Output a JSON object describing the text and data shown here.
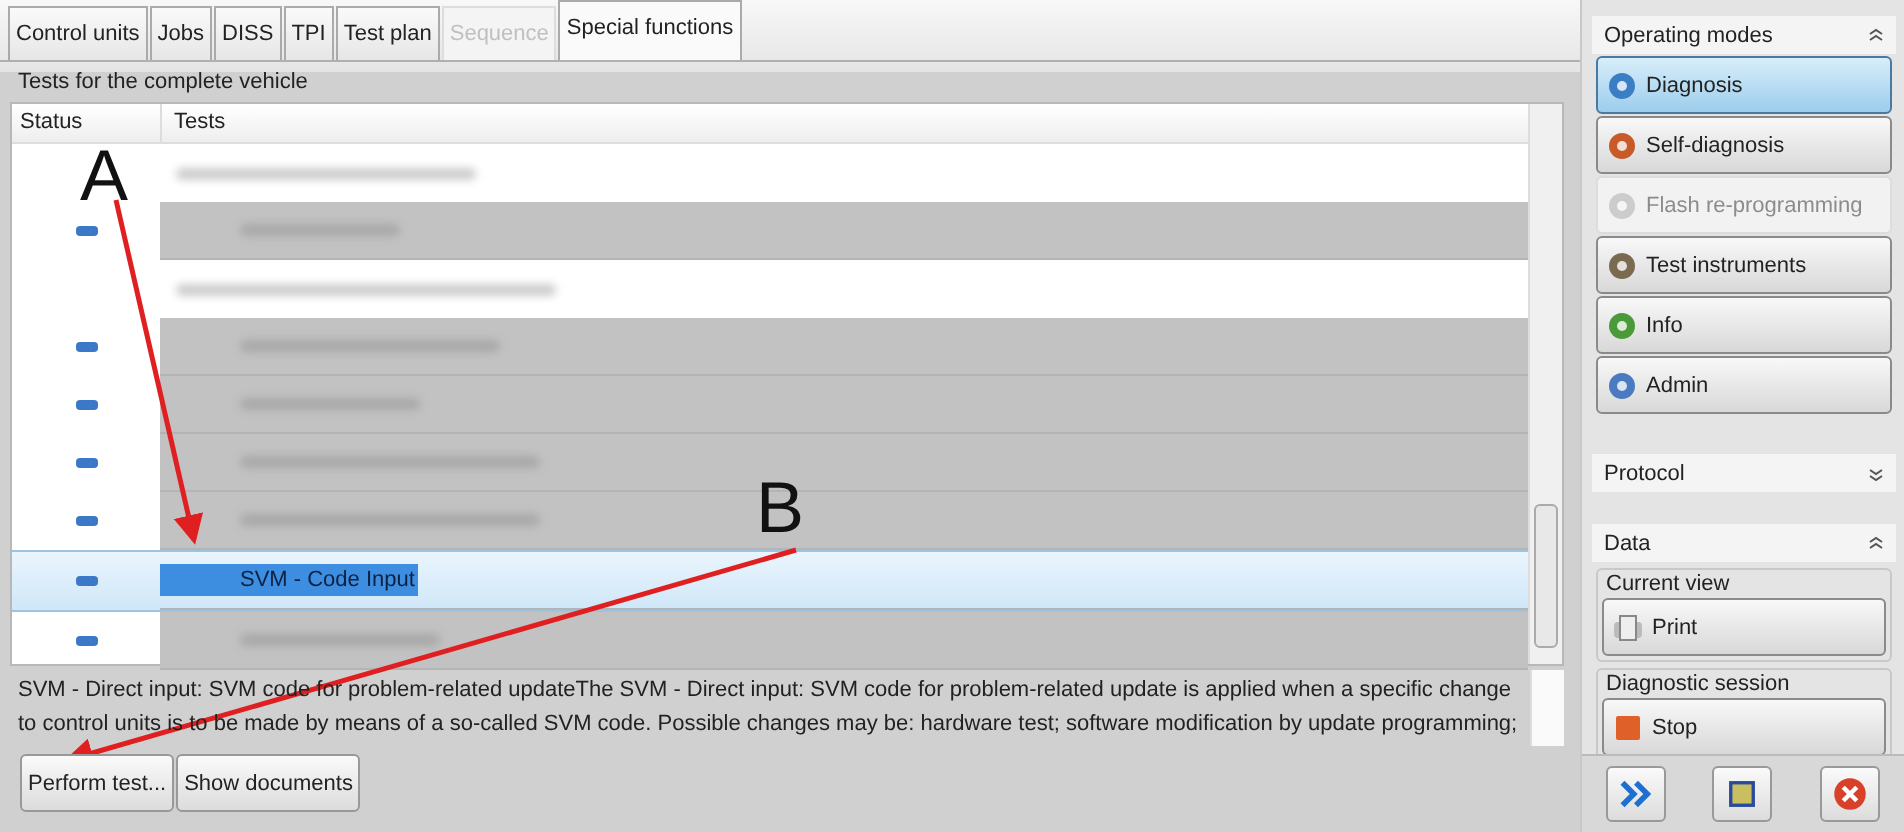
{
  "tabs": [
    {
      "label": "Control units",
      "selected": false,
      "disabled": false
    },
    {
      "label": "Jobs",
      "selected": false,
      "disabled": false
    },
    {
      "label": "DISS",
      "selected": false,
      "disabled": false
    },
    {
      "label": "TPI",
      "selected": false,
      "disabled": false
    },
    {
      "label": "Test plan",
      "selected": false,
      "disabled": false
    },
    {
      "label": "Sequence",
      "selected": false,
      "disabled": true
    },
    {
      "label": "Special functions",
      "selected": true,
      "disabled": false
    }
  ],
  "panel_title": "Tests for the complete vehicle",
  "table": {
    "columns": [
      "Status",
      "Tests"
    ],
    "rows": [
      {
        "kind": "group",
        "selected": false
      },
      {
        "kind": "test",
        "selected": false
      },
      {
        "kind": "group",
        "selected": false
      },
      {
        "kind": "test",
        "selected": false
      },
      {
        "kind": "test",
        "selected": false
      },
      {
        "kind": "test",
        "selected": false
      },
      {
        "kind": "test",
        "selected": false
      },
      {
        "kind": "test",
        "label": "SVM - Code Input",
        "selected": true
      },
      {
        "kind": "test",
        "selected": false
      }
    ]
  },
  "description": "SVM - Direct input: SVM code for problem-related updateThe SVM - Direct input: SVM code for problem-related update is applied when a specific change to control units is to be made by means of a so-called SVM code. Possible changes may be: hardware test; software modification by update programming;",
  "buttons": [
    "Perform test...",
    "Show documents"
  ],
  "operating_modes": {
    "title": "Operating modes",
    "expanded": true,
    "items": [
      {
        "label": "Diagnosis",
        "selected": true,
        "disabled": false
      },
      {
        "label": "Self-diagnosis",
        "selected": false,
        "disabled": false
      },
      {
        "label": "Flash re-programming",
        "selected": false,
        "disabled": true
      },
      {
        "label": "Test instruments",
        "selected": false,
        "disabled": false
      },
      {
        "label": "Info",
        "selected": false,
        "disabled": false
      },
      {
        "label": "Admin",
        "selected": false,
        "disabled": false
      }
    ]
  },
  "protocol": {
    "title": "Protocol",
    "expanded": false
  },
  "data": {
    "title": "Data",
    "expanded": true,
    "groups": [
      {
        "title": "Current view",
        "button": "Print"
      },
      {
        "title": "Diagnostic session",
        "button": "Stop"
      }
    ]
  },
  "annotations": [
    "A",
    "B"
  ]
}
